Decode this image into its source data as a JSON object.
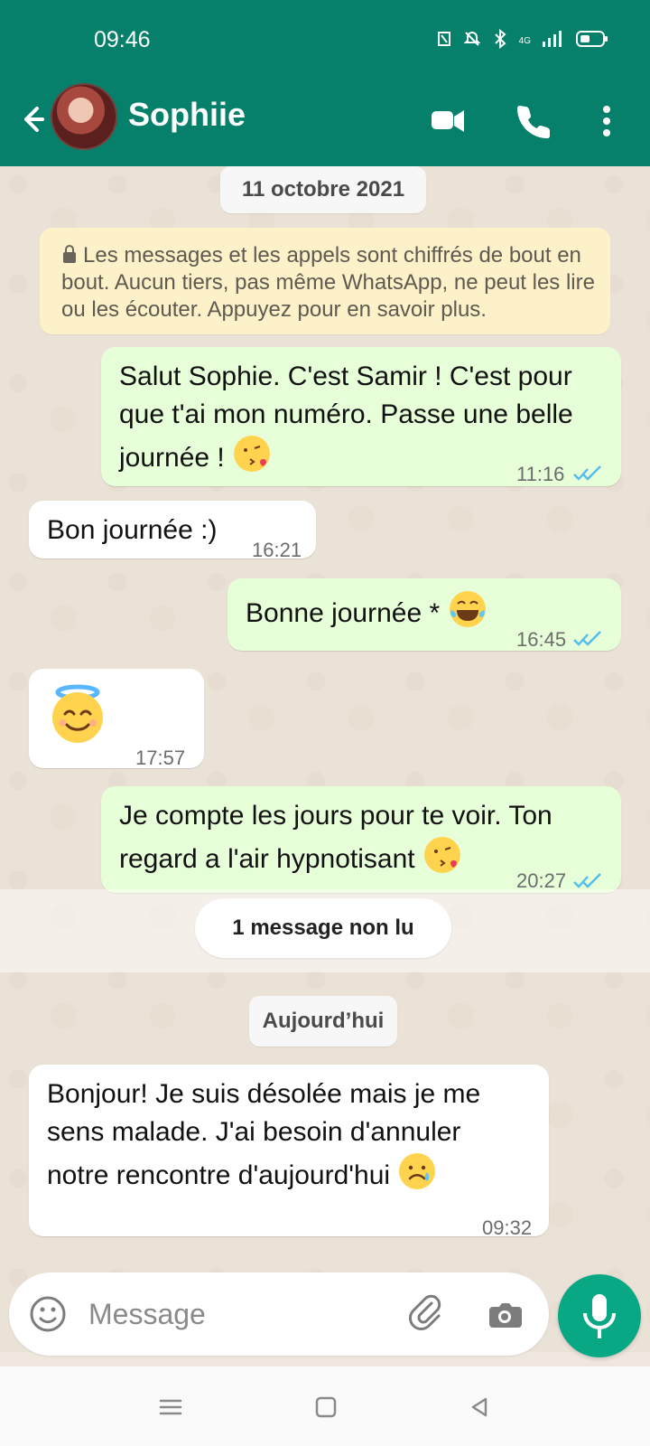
{
  "status_bar": {
    "time": "09:46",
    "network": "4G"
  },
  "header": {
    "contact_name": "Sophiie"
  },
  "chat": {
    "date_label_1": "11 octobre 2021",
    "encryption_notice": "Les messages et les appels sont chiffrés de bout en bout. Aucun tiers, pas même WhatsApp, ne peut les lire ou les écouter. Appuyez pour en savoir plus.",
    "messages": [
      {
        "side": "out",
        "text": "Salut Sophie. C'est Samir ! C'est pour que t'ai mon numéro. Passe une belle journée !",
        "emoji": "kiss-face",
        "time": "11:16"
      },
      {
        "side": "in",
        "text": "Bon journée :)",
        "time": "16:21"
      },
      {
        "side": "out",
        "text": "Bonne journée *",
        "emoji": "tears-of-joy",
        "time": "16:45"
      },
      {
        "side": "in",
        "text": "",
        "emoji": "smiling-with-halo",
        "time": "17:57"
      },
      {
        "side": "out",
        "text": "Je compte les jours pour te voir. Ton regard a l'air hypnotisant",
        "emoji": "kiss-face",
        "time": "20:27"
      },
      {
        "side": "in",
        "text": "Bonjour! Je suis désolée mais je me sens malade. J'ai besoin d'annuler notre rencontre d'aujourd'hui",
        "emoji": "sad-face",
        "time": "09:32"
      }
    ],
    "unread_label": "1 message non lu",
    "date_label_2": "Aujourd’hui"
  },
  "composer": {
    "placeholder": "Message"
  },
  "icons": {
    "back": "back-arrow-icon",
    "video": "video-call-icon",
    "call": "phone-icon",
    "more": "more-vertical-icon",
    "emoji": "emoji-icon",
    "attach": "paperclip-icon",
    "camera": "camera-icon",
    "mic": "microphone-icon",
    "lock": "lock-icon",
    "ticks": "double-check-icon"
  },
  "colors": {
    "header": "#06806b",
    "outgoing_bubble": "#e7ffd8",
    "incoming_bubble": "#ffffff",
    "notice": "#fdf1c9",
    "mic_button": "#08a884",
    "tick_blue": "#53bdeb"
  }
}
